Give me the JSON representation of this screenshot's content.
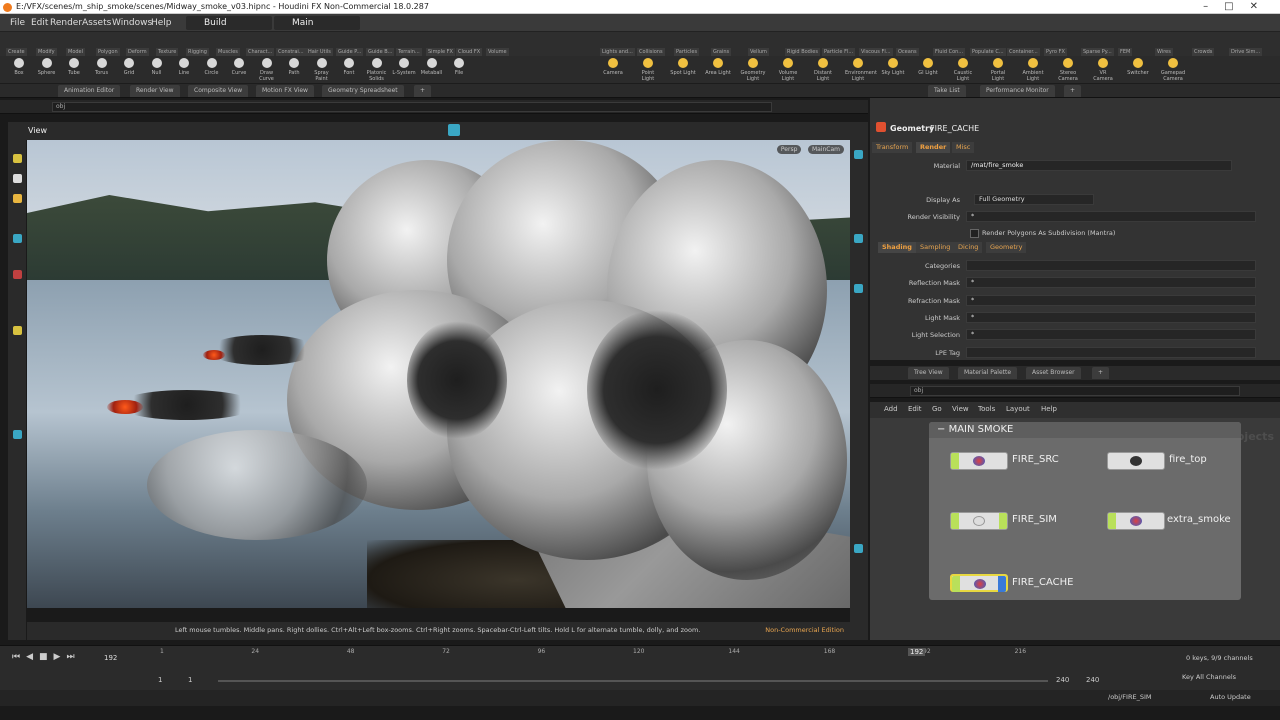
{
  "window": {
    "title": "E:/VFX/scenes/m_ship_smoke/scenes/Midway_smoke_v03.hipnc - Houdini FX Non-Commercial 18.0.287"
  },
  "menu": {
    "items": [
      "File",
      "Edit",
      "Render",
      "Assets",
      "Windows",
      "Help"
    ],
    "workspace_left": "Build",
    "workspace_right": "Main"
  },
  "shelf_tabs_left": [
    "Create",
    "Modify",
    "Model",
    "Polygon",
    "Deform",
    "Texture",
    "Rigging",
    "Muscles",
    "Charact...",
    "Constrai...",
    "Hair Utils",
    "Guide P...",
    "Guide B...",
    "Terrain...",
    "Simple FX",
    "Cloud FX",
    "Volume"
  ],
  "shelf_tabs_right": [
    "Lights and...",
    "Collisions",
    "Particles",
    "Grains",
    "Vellum",
    "Rigid Bodies",
    "Particle Fl...",
    "Viscous Fl...",
    "Oceans",
    "Fluid Con...",
    "Populate C...",
    "Container...",
    "Pyro FX",
    "Sparse Py...",
    "FEM",
    "Wires",
    "Crowds",
    "Drive Sim..."
  ],
  "tools_left": [
    "Box",
    "Sphere",
    "Tube",
    "Torus",
    "Grid",
    "Null",
    "Line",
    "Circle",
    "Curve",
    "Draw Curve",
    "Path",
    "Spray Paint",
    "Font",
    "Platonic Solids",
    "L-System",
    "Metaball",
    "File"
  ],
  "tools_right": [
    "Camera",
    "Point Light",
    "Spot Light",
    "Area Light",
    "Geometry Light",
    "Volume Light",
    "Distant Light",
    "Environment Light",
    "Sky Light",
    "GI Light",
    "Caustic Light",
    "Portal Light",
    "Ambient Light",
    "Stereo Camera",
    "VR Camera",
    "Switcher",
    "Gamepad Camera"
  ],
  "pane_tabs_left": [
    "Animation Editor",
    "Render View",
    "Composite View",
    "Motion FX View",
    "Geometry Spreadsheet"
  ],
  "pane_tabs_right": [
    "Take List",
    "Performance Monitor"
  ],
  "path": {
    "left": "obj",
    "right": "obj",
    "network": "obj"
  },
  "viewport": {
    "label": "View",
    "persp": "Persp",
    "cam": "MainCam",
    "status": "Left mouse tumbles. Middle pans. Right dollies. Ctrl+Alt+Left box-zooms. Ctrl+Right zooms. Spacebar-Ctrl-Left tilts. Hold L for alternate tumble, dolly, and zoom.",
    "edition": "Non-Commercial Edition"
  },
  "params": {
    "node_type": "Geometry",
    "node_name": "FIRE_CACHE",
    "tabs": [
      "Transform",
      "Render",
      "Misc"
    ],
    "material_label": "Material",
    "material_value": "/mat/fire_smoke",
    "display_as_label": "Display As",
    "display_as_value": "Full Geometry",
    "render_vis_label": "Render Visibility",
    "render_vis_value": "*",
    "subdiv_label": "Render Polygons As Subdivision (Mantra)",
    "subtabs": [
      "Shading",
      "Sampling",
      "Dicing",
      "Geometry"
    ],
    "rows": [
      {
        "label": "Categories",
        "value": ""
      },
      {
        "label": "Reflection Mask",
        "value": "*"
      },
      {
        "label": "Refraction Mask",
        "value": "*"
      },
      {
        "label": "Light Mask",
        "value": "*"
      },
      {
        "label": "Light Selection",
        "value": "*"
      },
      {
        "label": "LPE Tag",
        "value": ""
      }
    ]
  },
  "lower_tabs": [
    "Tree View",
    "Material Palette",
    "Asset Browser"
  ],
  "network_menu": [
    "Add",
    "Edit",
    "Go",
    "View",
    "Tools",
    "Layout",
    "Help"
  ],
  "network": {
    "watermark": "Objects",
    "box_title": "MAIN SMOKE",
    "nodes": [
      "FIRE_SRC",
      "fire_top",
      "FIRE_SIM",
      "extra_smoke",
      "FIRE_CACHE"
    ]
  },
  "timeline": {
    "frame": "192",
    "ticks": [
      "1",
      "24",
      "48",
      "72",
      "96",
      "120",
      "144",
      "168",
      "192",
      "216"
    ],
    "start": "1",
    "start2": "1",
    "end": "240",
    "end2": "240",
    "keys_info": "0 keys, 9/9 channels",
    "key_all": "Key All Channels"
  },
  "bottom": {
    "path": "/obj/FIRE_SIM",
    "auto_update": "Auto Update"
  }
}
